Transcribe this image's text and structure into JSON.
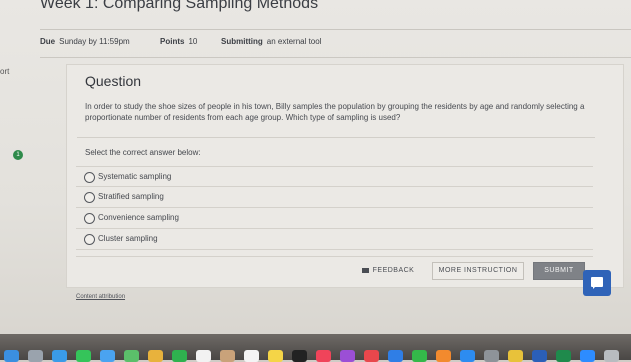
{
  "page": {
    "title": "Week 1: Comparing Sampling Methods",
    "side_label": "ort"
  },
  "meta": {
    "due_label": "Due",
    "due_value": "Sunday by 11:59pm",
    "points_label": "Points",
    "points_value": "10",
    "submitting_label": "Submitting",
    "submitting_value": "an external tool"
  },
  "question": {
    "heading": "Question",
    "text": "In order to study the shoe sizes of people in his town, Billy samples the population by grouping the residents by age and randomly selecting a proportionate number of residents from each age group. Which type of sampling is used?",
    "prompt": "Select the correct answer below:",
    "step_number": "1",
    "options": [
      {
        "label": "Systematic sampling"
      },
      {
        "label": "Stratified sampling"
      },
      {
        "label": "Convenience sampling"
      },
      {
        "label": "Cluster sampling"
      }
    ]
  },
  "actions": {
    "feedback": "FEEDBACK",
    "more_instruction": "MORE INSTRUCTION",
    "submit": "SUBMIT"
  },
  "footer": {
    "attribution": "Content attribution"
  },
  "icons": {
    "chat": "chat-bubble-icon",
    "feedback": "feedback-flag-icon",
    "radio": "radio-circle-icon"
  },
  "colors": {
    "submit_bg": "#7f8287",
    "chat_bg": "#2f63b8",
    "step_dot": "#2e8a4a"
  },
  "dock_apps": [
    {
      "name": "dock-app-finder",
      "color": "#3b8fe0"
    },
    {
      "name": "dock-app-launchpad",
      "color": "#9aa3ad"
    },
    {
      "name": "dock-app-safari",
      "color": "#3a9be8"
    },
    {
      "name": "dock-app-messages",
      "color": "#35c45a"
    },
    {
      "name": "dock-app-mail",
      "color": "#4aa3f0"
    },
    {
      "name": "dock-app-maps",
      "color": "#5bbf6a"
    },
    {
      "name": "dock-app-photos",
      "color": "#e8b23c"
    },
    {
      "name": "dock-app-facetime",
      "color": "#2fb24f"
    },
    {
      "name": "dock-app-calendar",
      "color": "#f2f2f2"
    },
    {
      "name": "dock-app-contacts",
      "color": "#c9a27a"
    },
    {
      "name": "dock-app-reminders",
      "color": "#f4f4f4"
    },
    {
      "name": "dock-app-notes",
      "color": "#f5d547"
    },
    {
      "name": "dock-app-tv",
      "color": "#222222"
    },
    {
      "name": "dock-app-music",
      "color": "#f0445a"
    },
    {
      "name": "dock-app-podcasts",
      "color": "#9b4fd6"
    },
    {
      "name": "dock-app-news",
      "color": "#e8474c"
    },
    {
      "name": "dock-app-keynote",
      "color": "#2f7ee6"
    },
    {
      "name": "dock-app-numbers",
      "color": "#34b84a"
    },
    {
      "name": "dock-app-pages",
      "color": "#f28a2e"
    },
    {
      "name": "dock-app-appstore",
      "color": "#2d8cf0"
    },
    {
      "name": "dock-app-settings",
      "color": "#8e9399"
    },
    {
      "name": "dock-app-chrome",
      "color": "#e8c23a"
    },
    {
      "name": "dock-app-word",
      "color": "#2b5fb8"
    },
    {
      "name": "dock-app-excel",
      "color": "#1f8a4c"
    },
    {
      "name": "dock-app-zoom",
      "color": "#2d8cff"
    },
    {
      "name": "dock-app-trash",
      "color": "#b8bcc0"
    }
  ]
}
